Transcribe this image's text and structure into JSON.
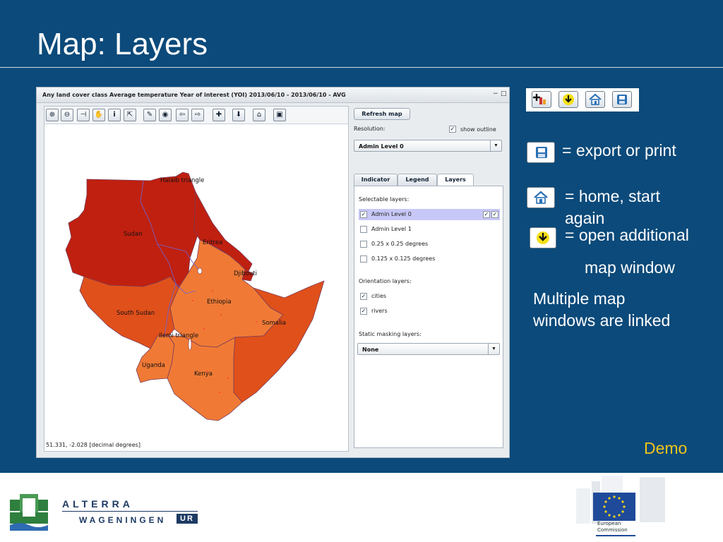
{
  "slide": {
    "title": "Map: Layers",
    "notes": {
      "export": "= export or print",
      "home_line1": "= home, start",
      "home_line2": "again",
      "open_line1": "= open additional",
      "open_line2": "map window",
      "linked_line1": "Multiple map",
      "linked_line2": "windows are linked",
      "demo": "Demo"
    }
  },
  "app": {
    "title": "Any land cover class Average temperature Year of interest (YOI) 2013/06/10 - 2013/06/10 - AVG",
    "window_controls": {
      "minimize": "−",
      "maximize": "□"
    },
    "coordinates": "51.331, -2.028 [decimal degrees]",
    "map_labels": [
      "Halaib triangle",
      "Sudan",
      "Eritrea",
      "Djibouti",
      "Ethiopia",
      "South Sudan",
      "Somalia",
      "Ilemi triangle",
      "Uganda",
      "Kenya"
    ],
    "toolbar_icons": [
      "zoom-in-icon",
      "zoom-out-icon",
      "measure-icon",
      "pan-hand-icon",
      "info-icon",
      "select-icon",
      "bookmark-icon",
      "globe-icon",
      "back-arrow-icon",
      "forward-arrow-icon",
      "add-chart-icon",
      "open-window-icon",
      "home-icon",
      "save-icon"
    ],
    "side": {
      "refresh": "Refresh map",
      "resolution_label": "Resolution:",
      "show_outline": "show outline",
      "resolution_value": "Admin Level 0",
      "tabs": [
        "Indicator",
        "Legend",
        "Layers"
      ],
      "selectable_title": "Selectable layers:",
      "selectable": [
        "Admin Level 0",
        "Admin Level 1",
        "0.25 x 0.25 degrees",
        "0.125 x 0.125 degrees"
      ],
      "orientation_title": "Orientation layers:",
      "orientation": [
        "cities",
        "rivers"
      ],
      "masking_title": "Static masking layers:",
      "masking_value": "None"
    }
  },
  "footer": {
    "logo1_line1": "ALTERRA",
    "logo1_line2": "WAGENINGEN",
    "logo1_ur": "UR",
    "logo2_line1": "European",
    "logo2_line2": "Commission"
  },
  "colors": {
    "slide_bg": "#0b4a7a",
    "demo": "#f0c419",
    "map_dark": "#c0200f",
    "map_mid": "#e0501a",
    "map_light": "#f07a35"
  }
}
